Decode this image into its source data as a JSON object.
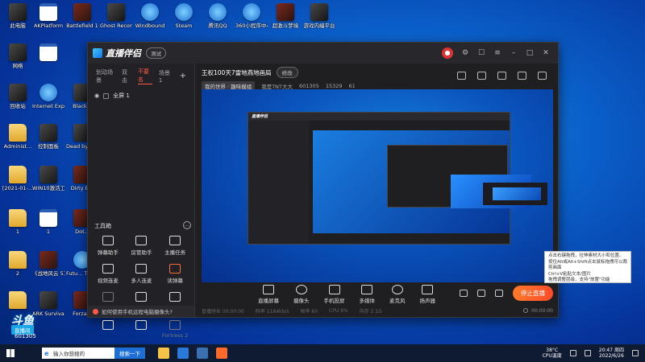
{
  "desktop_icons": [
    {
      "label": "此电脑",
      "kind": "dark"
    },
    {
      "label": "AKPlatform",
      "kind": "doc"
    },
    {
      "label": "Battlefield 1",
      "kind": "game"
    },
    {
      "label": "Ghost Recon®...",
      "kind": "dark"
    },
    {
      "label": "Windbound",
      "kind": "round"
    },
    {
      "label": "Steam",
      "kind": "round"
    },
    {
      "label": "腾讯QQ",
      "kind": "round"
    },
    {
      "label": "360小程序中心",
      "kind": "round"
    },
    {
      "label": "超激斗梦境",
      "kind": "game"
    },
    {
      "label": "游戏内编平台",
      "kind": "dark"
    },
    {
      "label": "网络",
      "kind": "dark"
    },
    {
      "label": "",
      "kind": "doc"
    },
    {
      "label": "回收站",
      "kind": "dark"
    },
    {
      "label": "Internet Explorer",
      "kind": "round"
    },
    {
      "label": "Black...",
      "kind": "dark"
    },
    {
      "label": "Administ...",
      "kind": "folder"
    },
    {
      "label": "控制面板",
      "kind": "dark"
    },
    {
      "label": "Dead by Daylig...",
      "kind": "dark"
    },
    {
      "label": "[2021-01-...",
      "kind": "folder"
    },
    {
      "label": "WIN10激活工具",
      "kind": "dark"
    },
    {
      "label": "Dirty B...",
      "kind": "game"
    },
    {
      "label": "1",
      "kind": "folder"
    },
    {
      "label": "1",
      "kind": "doc"
    },
    {
      "label": "Dot...",
      "kind": "game"
    },
    {
      "label": "2",
      "kind": "folder"
    },
    {
      "label": "《战地风云 5》",
      "kind": "game"
    },
    {
      "label": "Futu... Tran...",
      "kind": "round"
    },
    {
      "label": "",
      "kind": "folder"
    },
    {
      "label": "ARK Survival...",
      "kind": "dark"
    },
    {
      "label": "Forza...",
      "kind": "game"
    }
  ],
  "app": {
    "title": "直播伴侣",
    "beta": "测试",
    "scene_tabs": [
      "划动场景",
      "双击",
      "场景1",
      "场景 1"
    ],
    "scene_tabs_visible": [
      "划动场景",
      "双击",
      "不要名",
      "场景 1"
    ],
    "add_scene": "+",
    "scene_item": "全屏 1",
    "tools_title": "工具箱",
    "tools": [
      {
        "label": "弹幕助手",
        "state": "normal"
      },
      {
        "label": "房管助手",
        "state": "normal"
      },
      {
        "label": "主播任务",
        "state": "normal"
      },
      {
        "label": "视频连麦",
        "state": "normal"
      },
      {
        "label": "多人连麦",
        "state": "normal"
      },
      {
        "label": "读弹幕",
        "state": "hot"
      },
      {
        "label": "语音助手",
        "state": "dim"
      },
      {
        "label": "弹幕姬",
        "state": "normal"
      },
      {
        "label": "歌词助手",
        "state": "normal"
      },
      {
        "label": "",
        "state": "normal"
      },
      {
        "label": "",
        "state": "normal"
      },
      {
        "label": "Fortress 2",
        "state": "dim"
      }
    ],
    "tip": "如何使用手机远程电脑摄像头?",
    "stream_title": "王权100天7雷地燕地画局",
    "edit_label": "修改",
    "stream_tag": "我的世界 · 趣味模组",
    "streamer": "我是TNT大大",
    "room_id": "601305",
    "viewers": "15329",
    "fans": "61",
    "bottom_actions": [
      {
        "label": "直播屏幕",
        "shape": "square"
      },
      {
        "label": "摄像头",
        "shape": "round"
      },
      {
        "label": "手机投屏",
        "shape": "square"
      },
      {
        "label": "多媒体",
        "shape": "square"
      },
      {
        "label": "麦克风",
        "shape": "round"
      },
      {
        "label": "扬声器",
        "shape": "square"
      }
    ],
    "live_button": "停止直播",
    "status_items": [
      "直播时长 00:00:00",
      "码率 1164kb/s",
      "帧率 60",
      "CPU 9%",
      "内存 2.1G"
    ],
    "status_right": "00:00:00"
  },
  "popup_lines": [
    "点击右键拖拽，拉伸素材大小和位置。",
    "按住Alt或Alt+Shift点击鼠标拖拽可以裁剪画面",
    "Ctrl+V粘贴文本/图片",
    "拖拽调整层级，支持\"放置\"功能"
  ],
  "watermark": {
    "logo": "斗鱼",
    "tag": "直播间",
    "room": "601305"
  },
  "taskbar": {
    "search_placeholder": "输入你想搜的",
    "search_button": "搜索一下",
    "temp": "38°C",
    "temp_label": "CPU温度",
    "time": "20:47",
    "weekday": "周四",
    "date": "2022/6/26"
  },
  "colors": {
    "accent": "#ff5a4a",
    "live": "#ff6a2a",
    "brand": "#1076e6"
  }
}
